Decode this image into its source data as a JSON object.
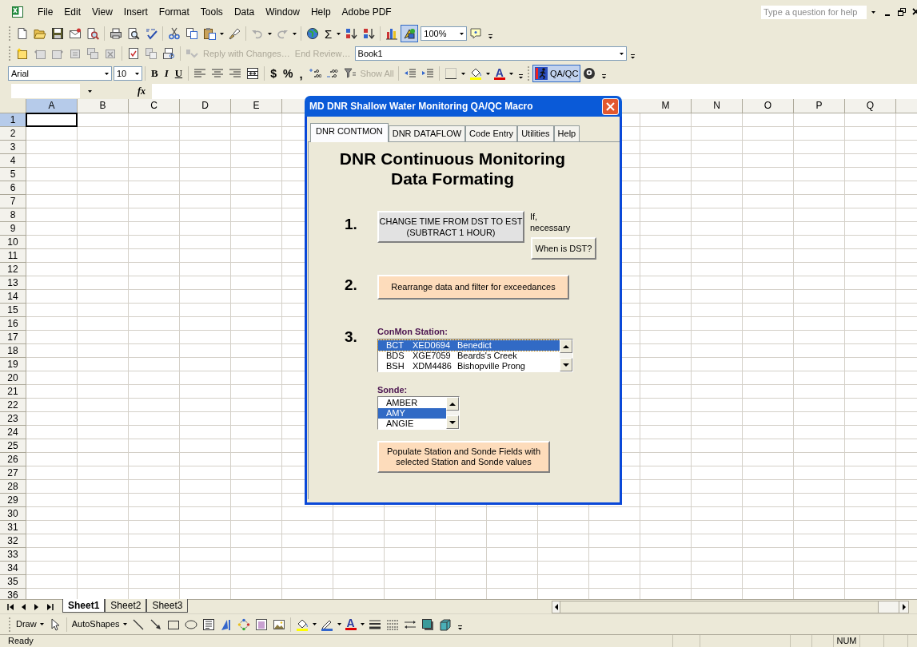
{
  "menu_bar": {
    "items": [
      "File",
      "Edit",
      "View",
      "Insert",
      "Format",
      "Tools",
      "Data",
      "Window",
      "Help",
      "Adobe PDF"
    ]
  },
  "help_search": {
    "placeholder": "Type a question for help"
  },
  "standard_toolbar": {
    "sum": "Σ",
    "zoom": "100%"
  },
  "reviewing_toolbar": {
    "reply": {
      "label": "Reply with Changes…",
      "disabled": true
    },
    "end_review": {
      "label": "End Review…",
      "disabled": true
    },
    "workbook": "Book1"
  },
  "formatting_toolbar": {
    "font": "Arial",
    "size": "10",
    "bold": "B",
    "italic": "I",
    "underline": "U",
    "currency": "$",
    "percent": "%",
    "comma": ",",
    "show_all": {
      "label": "Show All",
      "disabled": true
    },
    "font_color": "A",
    "macro": {
      "label": "QA/QC",
      "pressed": true
    }
  },
  "formula_bar": {
    "function": "fx"
  },
  "sheet": {
    "columns": [
      {
        "label": "A",
        "selected": true
      },
      {
        "label": "B",
        "selected": false
      },
      {
        "label": "C",
        "selected": false
      },
      {
        "label": "D",
        "selected": false
      },
      {
        "label": "E",
        "selected": false
      },
      {
        "label": "M",
        "selected": false
      },
      {
        "label": "N",
        "selected": false
      },
      {
        "label": "O",
        "selected": false
      },
      {
        "label": "P",
        "selected": false
      },
      {
        "label": "Q",
        "selected": false
      }
    ],
    "rows": [
      {
        "label": "1",
        "selected": true
      },
      {
        "label": "2",
        "selected": false
      },
      {
        "label": "3",
        "selected": false
      },
      {
        "label": "4",
        "selected": false
      },
      {
        "label": "5",
        "selected": false
      },
      {
        "label": "6",
        "selected": false
      },
      {
        "label": "7",
        "selected": false
      },
      {
        "label": "8",
        "selected": false
      },
      {
        "label": "9",
        "selected": false
      },
      {
        "label": "10",
        "selected": false
      },
      {
        "label": "11",
        "selected": false
      },
      {
        "label": "12",
        "selected": false
      },
      {
        "label": "13",
        "selected": false
      },
      {
        "label": "14",
        "selected": false
      },
      {
        "label": "15",
        "selected": false
      },
      {
        "label": "16",
        "selected": false
      },
      {
        "label": "17",
        "selected": false
      },
      {
        "label": "18",
        "selected": false
      },
      {
        "label": "19",
        "selected": false
      },
      {
        "label": "20",
        "selected": false
      },
      {
        "label": "21",
        "selected": false
      },
      {
        "label": "22",
        "selected": false
      },
      {
        "label": "23",
        "selected": false
      },
      {
        "label": "24",
        "selected": false
      },
      {
        "label": "25",
        "selected": false
      },
      {
        "label": "26",
        "selected": false
      },
      {
        "label": "27",
        "selected": false
      },
      {
        "label": "28",
        "selected": false
      },
      {
        "label": "29",
        "selected": false
      },
      {
        "label": "30",
        "selected": false
      },
      {
        "label": "31",
        "selected": false
      },
      {
        "label": "32",
        "selected": false
      },
      {
        "label": "33",
        "selected": false
      },
      {
        "label": "34",
        "selected": false
      },
      {
        "label": "35",
        "selected": false
      },
      {
        "label": "36",
        "selected": false
      }
    ]
  },
  "sheet_tabs": [
    {
      "label": "Sheet1",
      "selected": true
    },
    {
      "label": "Sheet2",
      "selected": false
    },
    {
      "label": "Sheet3",
      "selected": false
    }
  ],
  "drawing_toolbar": {
    "draw": "Draw",
    "autoshapes": "AutoShapes",
    "font_color": "A"
  },
  "status_bar": {
    "status": "Ready",
    "num_lock": "NUM"
  },
  "dialog": {
    "title": "MD DNR Shallow Water Monitoring QA/QC Macro",
    "tabs": [
      {
        "label": "DNR CONTMON",
        "selected": true
      },
      {
        "label": "DNR DATAFLOW",
        "selected": false
      },
      {
        "label": "Code Entry",
        "selected": false
      },
      {
        "label": "Utilities",
        "selected": false
      },
      {
        "label": "Help",
        "selected": false
      }
    ],
    "heading": [
      "DNR Continuous Monitoring",
      "Data Formating"
    ],
    "step_1": {
      "number": "1.",
      "button": "CHANGE TIME FROM DST TO EST\n(SUBTRACT 1 HOUR)",
      "note": "If,\nnecessary",
      "help_button": "When is DST?"
    },
    "step_2": {
      "number": "2.",
      "button": "Rearrange data and filter for exceedances"
    },
    "step_3": {
      "number": "3.",
      "station_label": "ConMon Station:",
      "stations": [
        {
          "code": "BCT",
          "id": "XED0694",
          "name": "Benedict",
          "selected": true
        },
        {
          "code": "BDS",
          "id": "XGE7059",
          "name": "Beards's Creek",
          "selected": false
        },
        {
          "code": "BSH",
          "id": "XDM4486",
          "name": "Bishopville Prong",
          "selected": false
        }
      ],
      "sonde_label": "Sonde:",
      "sondes": [
        {
          "name": "AMBER",
          "selected": false
        },
        {
          "name": "AMY",
          "selected": true
        },
        {
          "name": "ANGIE",
          "selected": false
        }
      ],
      "button": "Populate Station and Sonde Fields with\nselected Station and Sonde values"
    }
  }
}
